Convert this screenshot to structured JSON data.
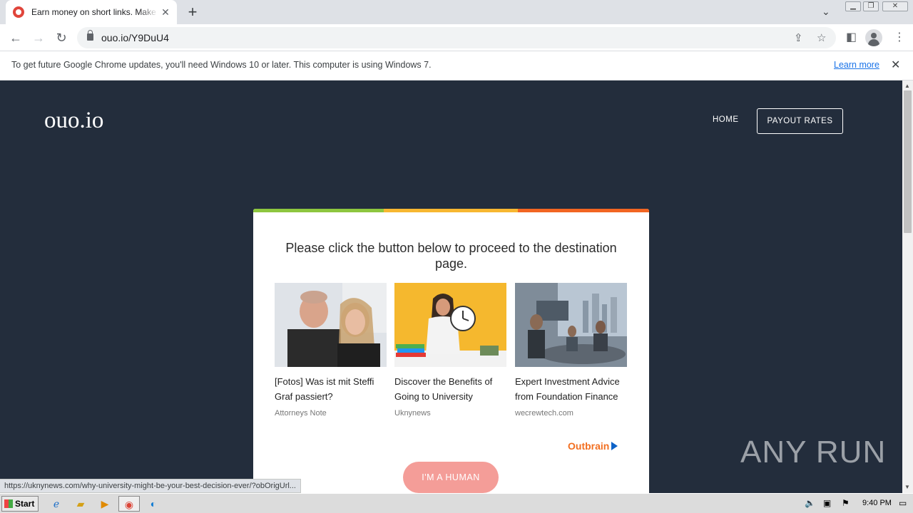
{
  "browser": {
    "tab_title": "Earn money on short links. Make short links and earn",
    "url": "ouo.io/Y9DuU4",
    "infobar_text": "To get future Google Chrome updates, you'll need Windows 10 or later. This computer is using Windows 7.",
    "infobar_link": "Learn more",
    "status_url": "https://uknynews.com/why-university-might-be-your-best-decision-ever/?obOrigUrl..."
  },
  "site": {
    "logo": "ouo.io",
    "nav_home": "HOME",
    "nav_payout": "PAYOUT RATES",
    "heading": "Please click the button below to proceed to the destination page.",
    "button": "I'M A HUMAN",
    "stripe_colors": [
      "#8dc63f",
      "#f7b731",
      "#f26522"
    ]
  },
  "ads": [
    {
      "title": "[Fotos] Was ist mit Steffi Graf passiert?",
      "source": "Attorneys Note"
    },
    {
      "title": "Discover the Benefits of Going to University",
      "source": "Uknynews"
    },
    {
      "title": "Expert Investment Advice from Foundation Finance",
      "source": "wecrewtech.com"
    }
  ],
  "ad_network": "Outbrain",
  "watermark": "ANY RUN",
  "taskbar": {
    "start": "Start",
    "clock": "9:40 PM"
  }
}
